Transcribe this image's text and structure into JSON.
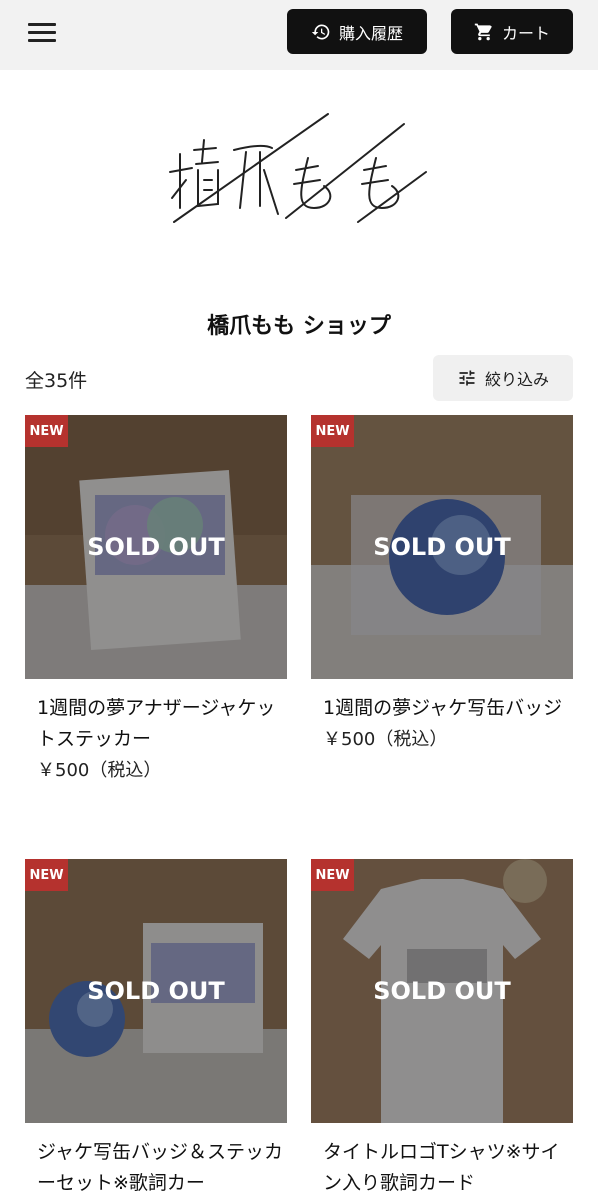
{
  "header": {
    "history_label": "購入履歴",
    "cart_label": "カート",
    "icons": [
      "menu-icon",
      "history-icon",
      "cart-icon"
    ]
  },
  "shop": {
    "title": "橋爪もも ショップ",
    "count": "全35件",
    "filter_label": "絞り込み"
  },
  "products": [
    {
      "badge": "NEW",
      "status": "SOLD OUT",
      "name": "1週間の夢アナザージャケットステッカー",
      "price": "￥500（税込）"
    },
    {
      "badge": "NEW",
      "status": "SOLD OUT",
      "name": "1週間の夢ジャケ写缶バッジ",
      "price": "￥500（税込）"
    },
    {
      "badge": "NEW",
      "status": "SOLD OUT",
      "name": "ジャケ写缶バッジ＆ステッカーセット※歌詞カー"
    },
    {
      "badge": "NEW",
      "status": "SOLD OUT",
      "name": "タイトルロゴTシャツ※サイン入り歌詞カード"
    }
  ],
  "colors": {
    "header_bg": "#f2f2f2",
    "button_bg": "#111111",
    "badge": "#b5322e"
  }
}
